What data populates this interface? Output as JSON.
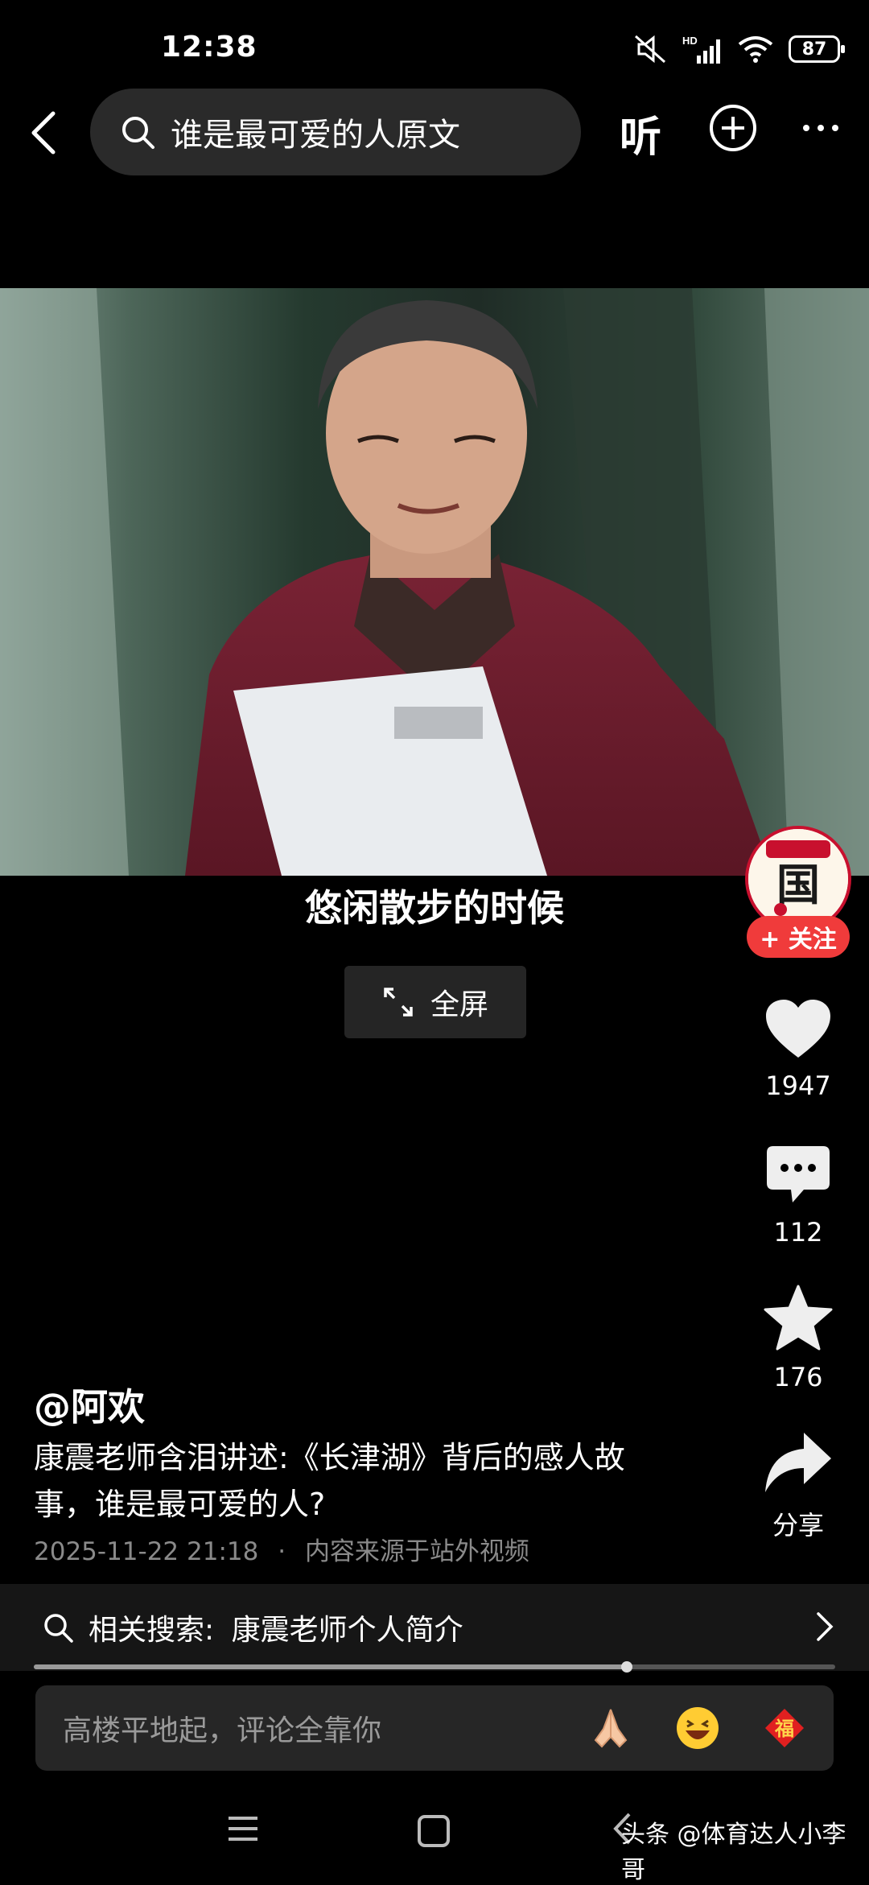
{
  "status_bar": {
    "time": "12:38",
    "battery": "87",
    "network": "HD"
  },
  "header": {
    "search_text": "谁是最可爱的人原文",
    "listen_label": "听"
  },
  "video": {
    "subtitle": "悠闲散步的时候",
    "fullscreen_label": "全屏"
  },
  "creator": {
    "follow_label": "+ 关注"
  },
  "actions": {
    "likes": "1947",
    "comments": "112",
    "favorites": "176",
    "share_label": "分享"
  },
  "post": {
    "author": "@阿欢",
    "caption": "康震老师含泪讲述:《长津湖》背后的感人故事，谁是最可爱的人?",
    "timestamp": "2025-11-22 21:18",
    "separator": "·",
    "source": "内容来源于站外视频",
    "progress": 0.74
  },
  "related_search": {
    "prefix": "相关搜索:",
    "query": "康震老师个人简介"
  },
  "comment": {
    "placeholder": "高楼平地起，评论全靠你"
  },
  "watermark": "头条 @体育达人小李哥",
  "colors": {
    "accent_red": "#f03b3b",
    "background": "#000000",
    "pill": "#2a2a2a"
  }
}
